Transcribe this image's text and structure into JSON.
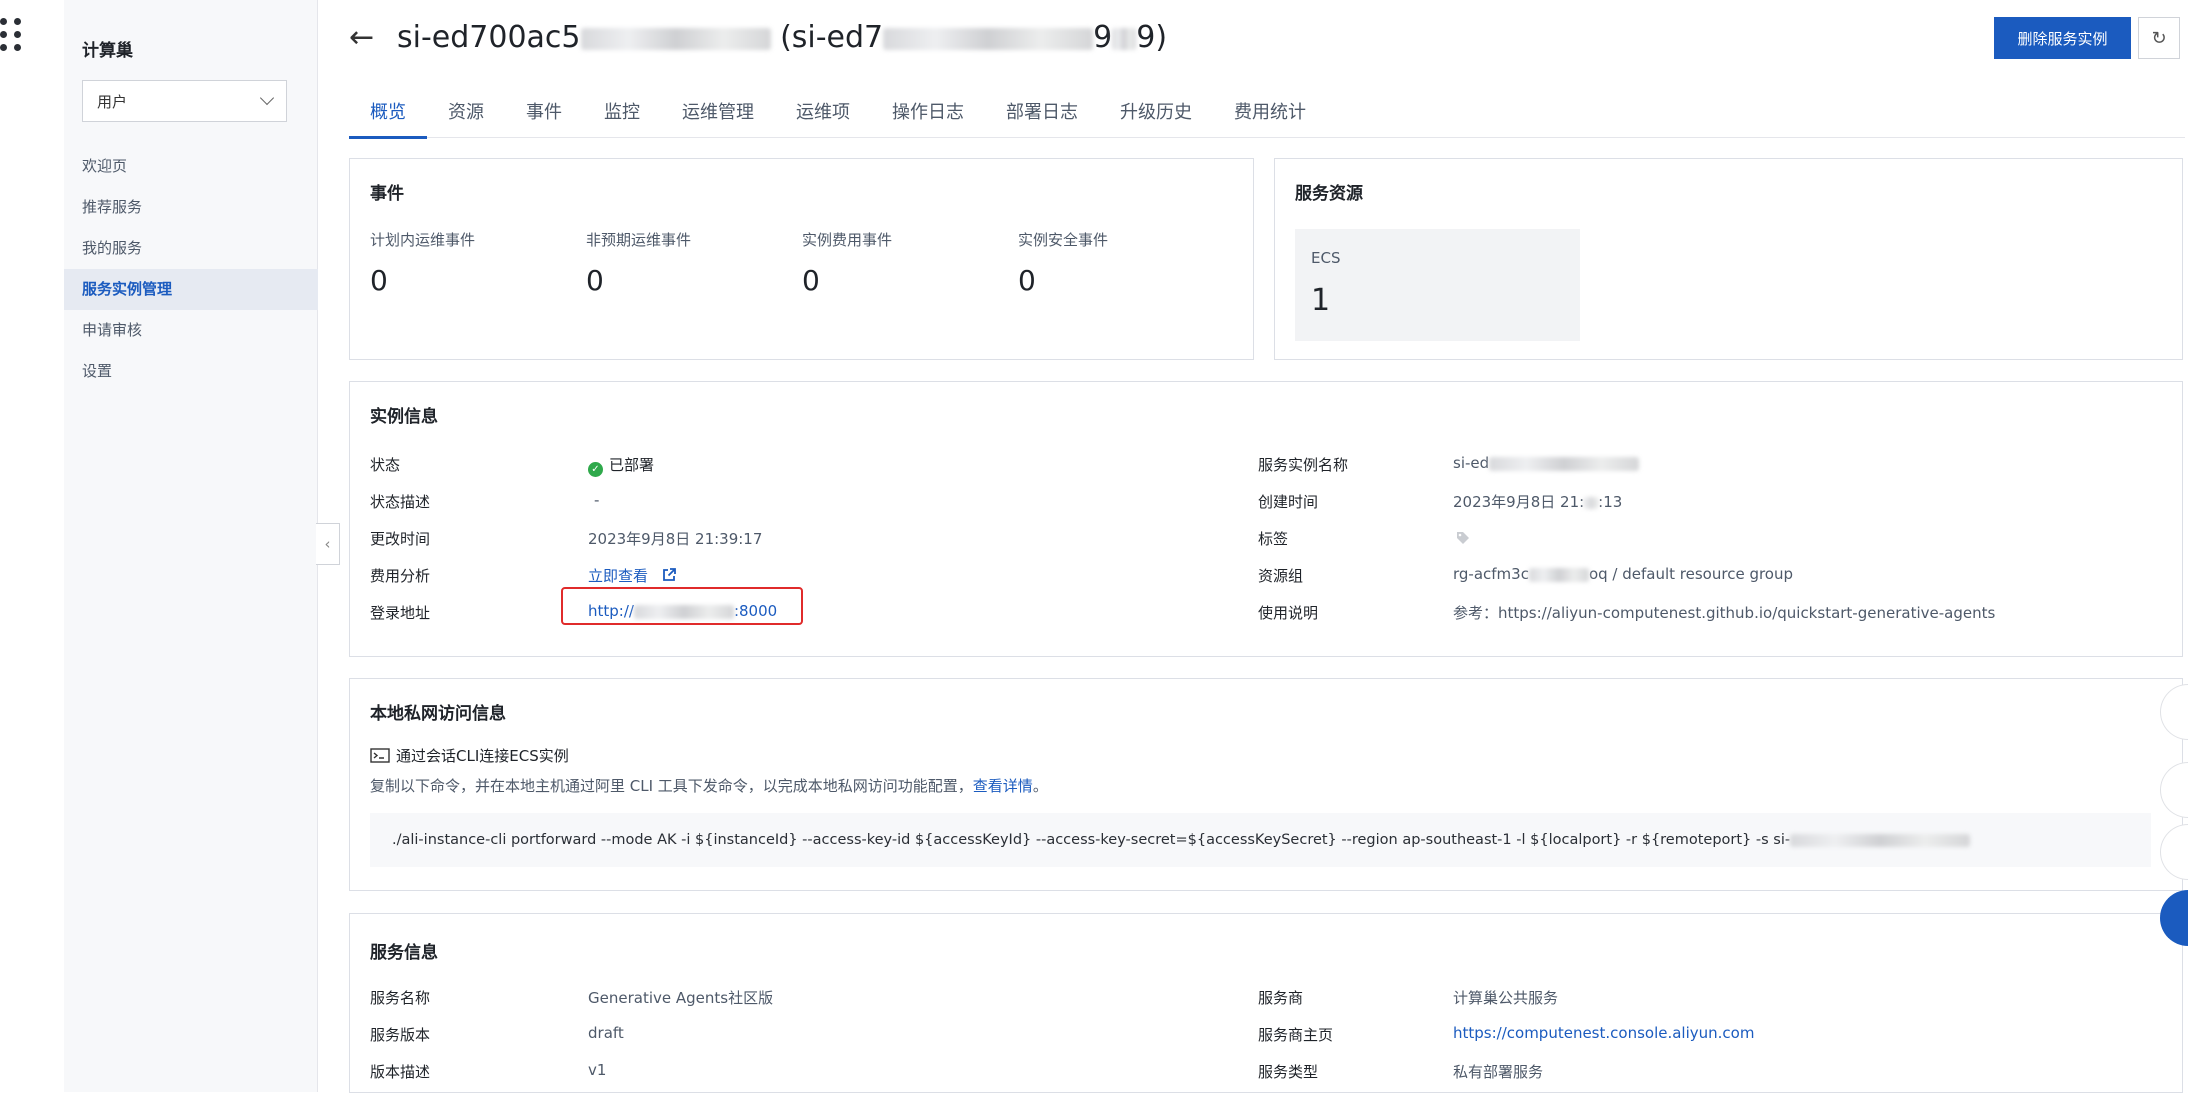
{
  "sidebar": {
    "title": "计算巢",
    "role_select": "用户",
    "items": [
      {
        "label": "欢迎页"
      },
      {
        "label": "推荐服务"
      },
      {
        "label": "我的服务"
      },
      {
        "label": "服务实例管理"
      },
      {
        "label": "申请审核"
      },
      {
        "label": "设置"
      }
    ]
  },
  "header": {
    "title_prefix": "si-ed700ac5",
    "title_mid": "(si-ed7",
    "title_suffix": "9",
    "title_end": "9)",
    "delete_button": "删除服务实例",
    "refresh_icon": "↻"
  },
  "tabs": [
    "概览",
    "资源",
    "事件",
    "监控",
    "运维管理",
    "运维项",
    "操作日志",
    "部署日志",
    "升级历史",
    "费用统计"
  ],
  "events_card": {
    "title": "事件",
    "stats": [
      {
        "label": "计划内运维事件",
        "value": "0"
      },
      {
        "label": "非预期运维事件",
        "value": "0"
      },
      {
        "label": "实例费用事件",
        "value": "0"
      },
      {
        "label": "实例安全事件",
        "value": "0"
      }
    ]
  },
  "resources_card": {
    "title": "服务资源",
    "ecs_label": "ECS",
    "ecs_count": "1"
  },
  "instance_info": {
    "title": "实例信息",
    "left": {
      "status_label": "状态",
      "status_value": "已部署",
      "status_desc_label": "状态描述",
      "status_desc_value": "-",
      "modified_label": "更改时间",
      "modified_value": "2023年9月8日 21:39:17",
      "cost_label": "费用分析",
      "cost_link": "立即查看",
      "login_label": "登录地址",
      "login_prefix": "http://",
      "login_suffix": ":8000"
    },
    "right": {
      "name_label": "服务实例名称",
      "name_value": "si-ed",
      "created_label": "创建时间",
      "created_value": "2023年9月8日 21:",
      "created_value_end": ":13",
      "tag_label": "标签",
      "rg_label": "资源组",
      "rg_prefix": "rg-acfm3c",
      "rg_suffix": "oq / default resource group",
      "usage_label": "使用说明",
      "usage_value": "参考：https://aliyun-computenest.github.io/quickstart-generative-agents"
    }
  },
  "private_access": {
    "title": "本地私网访问信息",
    "subtitle": "通过会话CLI连接ECS实例",
    "desc": "复制以下命令，并在本地主机通过阿里 CLI 工具下发命令，以完成本地私网访问功能配置，",
    "desc_link": "查看详情",
    "desc_end": "。",
    "command": "./ali-instance-cli portforward --mode AK -i ${instanceId} --access-key-id ${accessKeyId} --access-key-secret=${accessKeySecret} --region ap-southeast-1 -l ${localport} -r ${remoteport} -s si-"
  },
  "service_info": {
    "title": "服务信息",
    "left": {
      "name_label": "服务名称",
      "name_value": "Generative Agents社区版",
      "version_label": "服务版本",
      "version_value": "draft",
      "desc_label": "版本描述",
      "desc_value": "v1"
    },
    "right": {
      "provider_label": "服务商",
      "provider_value": "计算巢公共服务",
      "homepage_label": "服务商主页",
      "homepage_value": "https://computenest.console.aliyun.com",
      "type_label": "服务类型",
      "type_value": "私有部署服务"
    }
  },
  "colors": {
    "accent": "#1b5bbf",
    "success": "#2fa94b",
    "highlight": "#e02b2b"
  }
}
